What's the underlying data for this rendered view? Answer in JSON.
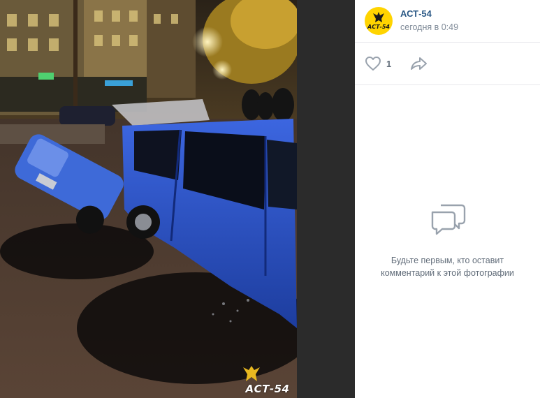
{
  "photo": {
    "watermark_text": "АСТ-54"
  },
  "post": {
    "author": "АСТ-54",
    "avatar_text": "АСТ-54",
    "date": "сегодня в 0:49"
  },
  "actions": {
    "like_count": "1",
    "like_icon": "heart-icon",
    "share_icon": "share-arrow-icon"
  },
  "comments": {
    "empty_icon": "comments-icon",
    "empty_line1": "Будьте первым, кто оставит",
    "empty_line2": "комментарий к этой фотографии"
  },
  "colors": {
    "brand_yellow": "#ffd400",
    "link_blue": "#2a5885",
    "icon_gray": "#99a2ad",
    "car_blue": "#2952c8"
  }
}
